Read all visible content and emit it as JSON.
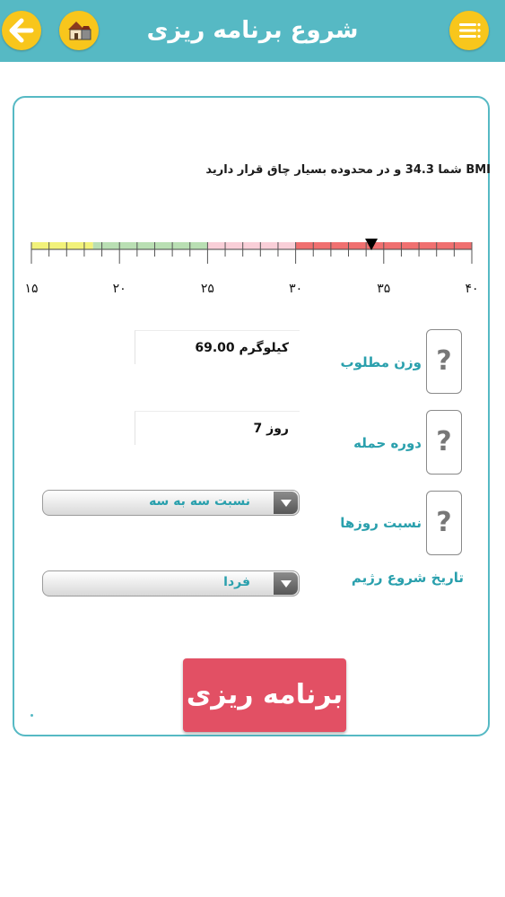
{
  "header": {
    "title": "شروع برنامه ریزی",
    "back_icon": "arrow-left-icon",
    "home_icon": "home-icon",
    "menu_icon": "menu-list-icon",
    "bg_color": "#56b9c4",
    "button_color": "#f8c61c"
  },
  "bmi": {
    "message": "BMI شما 34.3 و در محدوده بسیار چاق قرار دارید",
    "value": 34.3,
    "scale_labels": [
      "۱۵",
      "۲۰",
      "۲۵",
      "۳۰",
      "۳۵",
      "۴۰"
    ],
    "scale_min": 15,
    "scale_max": 40,
    "zones": [
      {
        "from": 15,
        "to": 18.5,
        "color": "#f2f27a"
      },
      {
        "from": 18.5,
        "to": 25,
        "color": "#b9dfb3"
      },
      {
        "from": 25,
        "to": 30,
        "color": "#f9cfd8"
      },
      {
        "from": 30,
        "to": 40,
        "color": "#f07070"
      }
    ]
  },
  "form": {
    "target_weight": {
      "label": "وزن مطلوب",
      "value": "69.00 کیلوگرم"
    },
    "attack_period": {
      "label": "دوره حمله",
      "value": "7 روز"
    },
    "day_ratio": {
      "label": "نسبت روزها",
      "value": "نسبت سه به سه"
    },
    "start_date": {
      "label": "تاریخ شروع رژیم",
      "value": "فردا"
    },
    "help_symbol": "?"
  },
  "actions": {
    "plan_label": "برنامه ریزی",
    "plan_color": "#e25064"
  }
}
